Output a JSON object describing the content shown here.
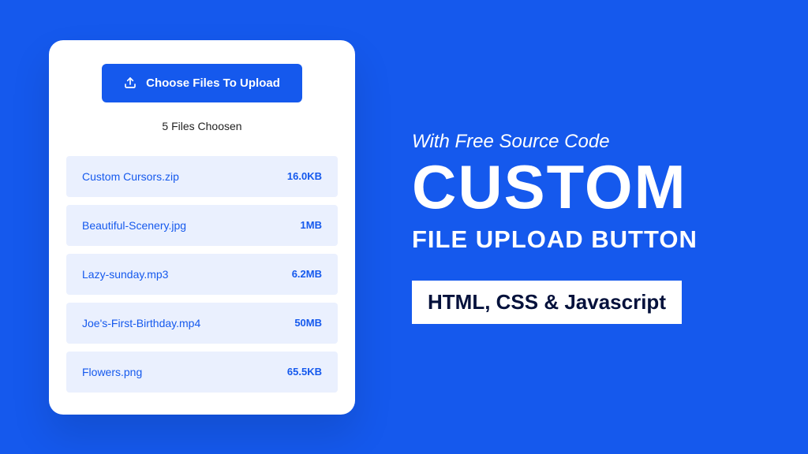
{
  "card": {
    "button_label": "Choose Files To Upload",
    "files_count_text": "5 Files Choosen",
    "files": [
      {
        "name": "Custom Cursors.zip",
        "size": "16.0KB"
      },
      {
        "name": "Beautiful-Scenery.jpg",
        "size": "1MB"
      },
      {
        "name": "Lazy-sunday.mp3",
        "size": "6.2MB"
      },
      {
        "name": "Joe's-First-Birthday.mp4",
        "size": "50MB"
      },
      {
        "name": "Flowers.png",
        "size": "65.5KB"
      }
    ]
  },
  "title_block": {
    "subtitle": "With Free Source Code",
    "main": "CUSTOM",
    "sub": "FILE UPLOAD BUTTON",
    "tech": "HTML, CSS & Javascript"
  },
  "colors": {
    "background": "#1559ed",
    "card_bg": "#ffffff",
    "file_row_bg": "#eaf0fe",
    "accent": "#1559ed"
  }
}
